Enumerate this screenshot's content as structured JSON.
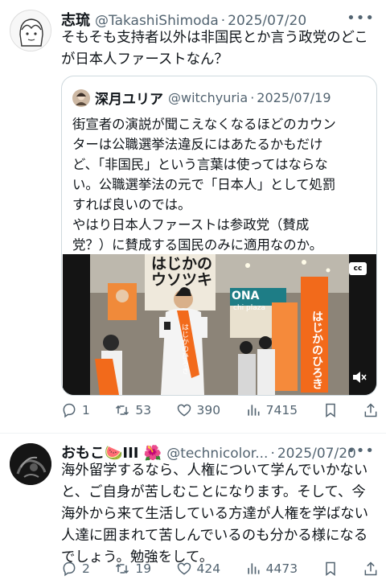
{
  "post1": {
    "name": "志琉",
    "handle": "@TakashiShimoda",
    "date": "2025/07/20",
    "more": "•••",
    "text": "そもそも支持者以外は非国民とか言う政党のどこ\nが日本人ファーストなん？",
    "quote": {
      "name": "深月ユリア",
      "handle": "@witchyuria",
      "date": "2025/07/19",
      "text": "街宣者の演説が聞こえなくなるほどのカウン\nターは公職選挙法違反にはあたるかもだけ\nど、「非国民」という言葉は使ってはならな\nい。公職選挙法の元で「日本人」として処罰\nすれば良いのでは。\nやはり日本人ファーストは参政党（賛成\n党？）に賛成する国民のみに適用なのか。",
      "video": {
        "cc": "cc",
        "banner_left": "はじかの",
        "banner_mid": "ウソツキ",
        "store_sign": "ONA",
        "store_sub": "chi plaza",
        "sash_text": "はじかのひろき",
        "flag_text": "はじかのひろき"
      }
    },
    "actions": {
      "replies": "1",
      "reposts": "53",
      "likes": "390",
      "views": "7415"
    }
  },
  "post2": {
    "name": "おもこ🍉III 🌺",
    "handle": "@technicolor...",
    "date": "2025/07/20",
    "text": "海外留学するなら、人権について学んでいかない\nと、ご自身が苦しむことになります。そして、今\n海外から来て生活している方達が人権を学ばない\n人達に囲まれて苦しんでいるのも分かる様になる\nでしょう。勉強をして。",
    "actions": {
      "replies": "2",
      "reposts": "19",
      "likes": "424",
      "views": "4473"
    }
  },
  "colors": {
    "text": "#0f1419",
    "muted": "#536471",
    "border": "#cfd9de",
    "orange": "#f26a1b"
  }
}
